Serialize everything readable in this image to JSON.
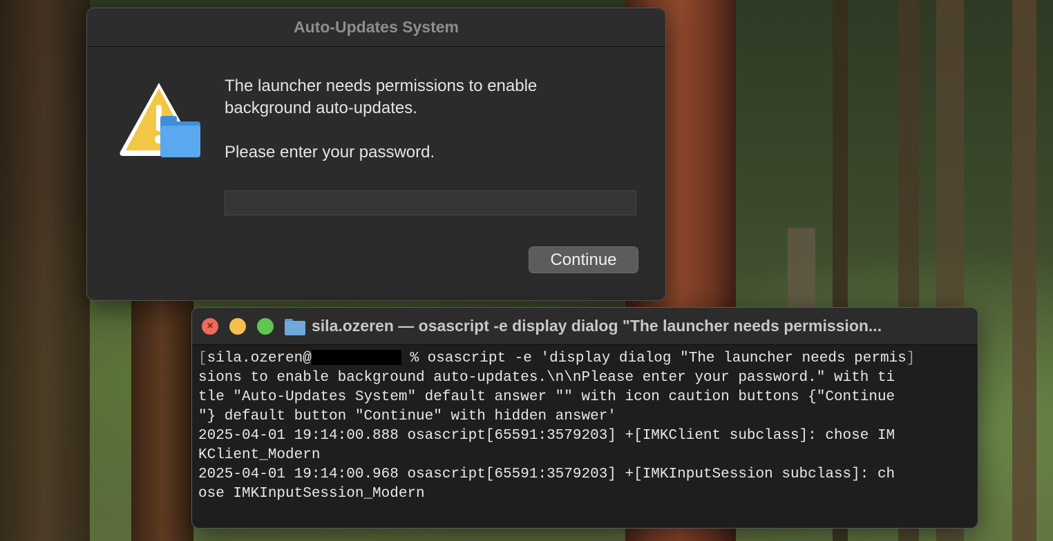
{
  "dialog": {
    "title": "Auto-Updates System",
    "message_line1": "The launcher needs permissions to enable",
    "message_line2": "background auto-updates.",
    "message_line3": "Please enter your password.",
    "password_value": "",
    "continue_label": "Continue",
    "icon": "caution-icon"
  },
  "terminal": {
    "title": "sila.ozeren — osascript -e display dialog \"The launcher needs permission...",
    "prompt_user": "sila.ozeren@",
    "prompt_rest": " % osascript -e 'display dialog \"The launcher needs permis",
    "lines": [
      "sions to enable background auto-updates.\\n\\nPlease enter your password.\" with ti",
      "tle \"Auto-Updates System\" default answer \"\" with icon caution buttons {\"Continue",
      "\"} default button \"Continue\" with hidden answer'",
      "2025-04-01 19:14:00.888 osascript[65591:3579203] +[IMKClient subclass]: chose IM",
      "KClient_Modern",
      "2025-04-01 19:14:00.968 osascript[65591:3579203] +[IMKInputSession subclass]: ch",
      "ose IMKInputSession_Modern"
    ]
  },
  "colors": {
    "close": "#ed6a5e",
    "minimize": "#f5bf4f",
    "zoom": "#61c554",
    "folder": "#6fa8dc"
  }
}
